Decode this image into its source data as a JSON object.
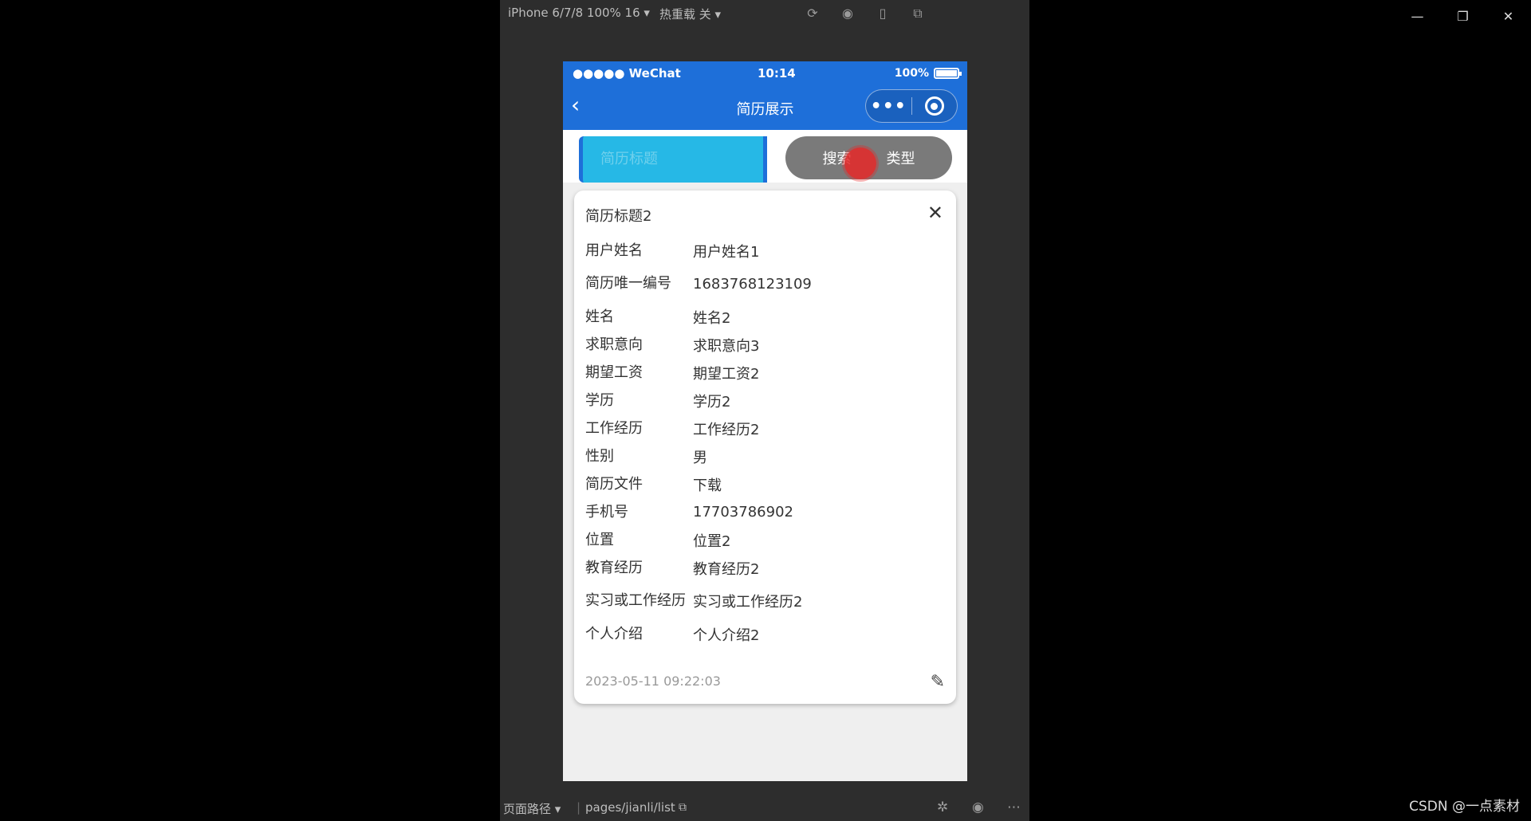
{
  "window_controls": {
    "minimize": "—",
    "restore": "❐",
    "close": "✕"
  },
  "simulator": {
    "device": "iPhone 6/7/8 100% 16 ▾",
    "hot_reload": "热重载 关 ▾"
  },
  "status_bar": {
    "carrier": "●●●●● WeChat",
    "time": "10:14",
    "battery": "100%"
  },
  "nav": {
    "back": "‹",
    "title": "简历展示",
    "more": "•••"
  },
  "search": {
    "placeholder": "简历标题",
    "button_left": "搜索",
    "button_right": "类型"
  },
  "card": {
    "title": "简历标题2",
    "close": "✕",
    "fields": [
      {
        "label": "用户姓名",
        "value": "用户姓名1"
      },
      {
        "label": "简历唯一编号",
        "value": "1683768123109"
      },
      {
        "label": "姓名",
        "value": "姓名2"
      },
      {
        "label": "求职意向",
        "value": "求职意向3"
      },
      {
        "label": "期望工资",
        "value": "期望工资2"
      },
      {
        "label": "学历",
        "value": "学历2"
      },
      {
        "label": "工作经历",
        "value": "工作经历2"
      },
      {
        "label": "性别",
        "value": "男"
      },
      {
        "label": "简历文件",
        "value": "下载"
      },
      {
        "label": "手机号",
        "value": "17703786902"
      },
      {
        "label": "位置",
        "value": "位置2"
      },
      {
        "label": "教育经历",
        "value": "教育经历2"
      },
      {
        "label": "实习或工作经历",
        "value": "实习或工作经历2"
      },
      {
        "label": "个人介绍",
        "value": "个人介绍2"
      }
    ],
    "date": "2023-05-11 09:22:03"
  },
  "bottom_bar": {
    "path_label": "页面路径 ▾",
    "separator": "|",
    "path": "pages/jianli/list"
  },
  "watermark": "CSDN @一点素材"
}
